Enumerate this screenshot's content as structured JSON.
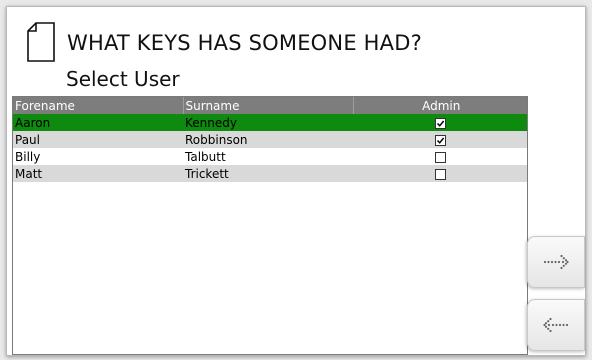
{
  "header": {
    "title": "WHAT KEYS HAS SOMEONE HAD?",
    "subtitle": "Select User",
    "icon": "document-icon"
  },
  "table": {
    "columns": [
      "Forename",
      "Surname",
      "Admin"
    ],
    "rows": [
      {
        "forename": "Aaron",
        "surname": "Kennedy",
        "admin": true,
        "selected": true
      },
      {
        "forename": "Paul",
        "surname": "Robbinson",
        "admin": true,
        "selected": false
      },
      {
        "forename": "Billy",
        "surname": "Talbutt",
        "admin": false,
        "selected": false
      },
      {
        "forename": "Matt",
        "surname": "Trickett",
        "admin": false,
        "selected": false
      }
    ]
  },
  "nav": {
    "next_icon": "dotted-arrow-right-icon",
    "back_icon": "dotted-arrow-left-icon"
  },
  "colors": {
    "selected_row": "#0e8a0e",
    "header_bg": "#7d7d7d",
    "alt_row": "#d9d9d9"
  }
}
